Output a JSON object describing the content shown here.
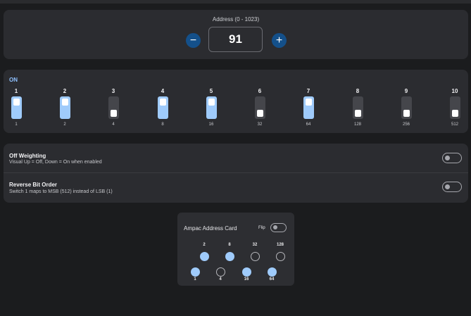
{
  "address": {
    "label": "Address (0 - 1023)",
    "value": "91",
    "minus_icon": "minus-icon",
    "plus_icon": "plus-icon",
    "minus_glyph": "−",
    "plus_glyph": "+",
    "accent_color": "#14508a"
  },
  "switches": {
    "on_label": "ON",
    "items": [
      {
        "num": "1",
        "value": "1",
        "state": "on"
      },
      {
        "num": "2",
        "value": "2",
        "state": "on"
      },
      {
        "num": "3",
        "value": "4",
        "state": "off"
      },
      {
        "num": "4",
        "value": "8",
        "state": "on"
      },
      {
        "num": "5",
        "value": "16",
        "state": "on"
      },
      {
        "num": "6",
        "value": "32",
        "state": "off"
      },
      {
        "num": "7",
        "value": "64",
        "state": "on"
      },
      {
        "num": "8",
        "value": "128",
        "state": "off"
      },
      {
        "num": "9",
        "value": "256",
        "state": "off"
      },
      {
        "num": "10",
        "value": "512",
        "state": "off"
      }
    ],
    "on_color": "#9fcbfb",
    "off_color": "#45464b"
  },
  "options": {
    "off_weighting": {
      "title": "Off Weighting",
      "description": "Visual Up = Off, Down = On when enabled",
      "enabled": false
    },
    "reverse_bit_order": {
      "title": "Reverse Bit Order",
      "description": "Switch 1 maps to MSB (512) instead of LSB (1)",
      "enabled": false
    }
  },
  "card": {
    "title": "Ampac Address Card",
    "flip_label": "Flip",
    "flip_enabled": false,
    "top_row": [
      {
        "label": "2",
        "state": "on"
      },
      {
        "label": "8",
        "state": "on"
      },
      {
        "label": "32",
        "state": "off"
      },
      {
        "label": "128",
        "state": "off"
      }
    ],
    "bottom_row": [
      {
        "label": "1",
        "state": "on"
      },
      {
        "label": "4",
        "state": "off"
      },
      {
        "label": "16",
        "state": "on"
      },
      {
        "label": "64",
        "state": "on"
      }
    ]
  }
}
